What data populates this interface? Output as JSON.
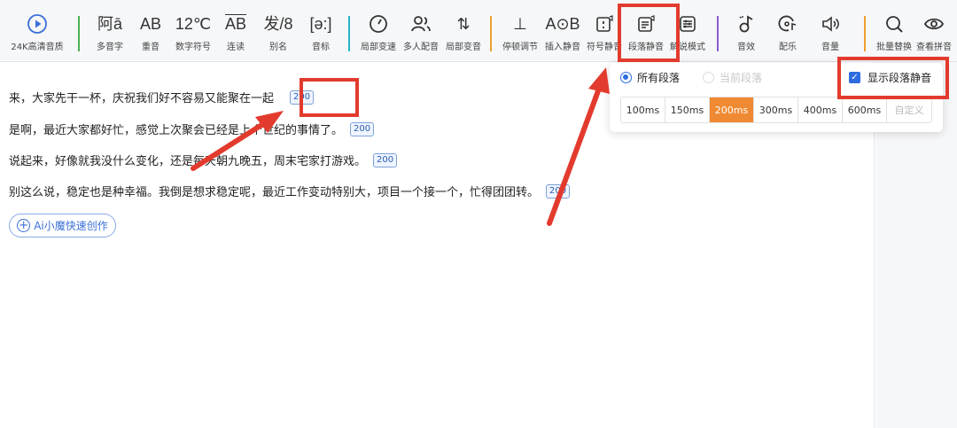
{
  "toolbar": {
    "items": [
      {
        "label": "24K高清音质",
        "icon": "play-circle-icon",
        "glyph": ""
      },
      {
        "label": "多音字",
        "icon": "polyphone-icon",
        "glyph": "阿ā"
      },
      {
        "label": "重音",
        "icon": "stress-icon",
        "glyph": "AB"
      },
      {
        "label": "数字符号",
        "icon": "number-symbol-icon",
        "glyph": "12℃"
      },
      {
        "label": "连读",
        "icon": "liaison-icon",
        "glyph": "AB"
      },
      {
        "label": "别名",
        "icon": "alias-icon",
        "glyph": "发/8"
      },
      {
        "label": "音标",
        "icon": "phonetic-icon",
        "glyph": "[ə:]"
      },
      {
        "label": "局部变速",
        "icon": "speedometer-icon",
        "glyph": "◔"
      },
      {
        "label": "多人配音",
        "icon": "multi-user-icon",
        "glyph": "⚇"
      },
      {
        "label": "局部变音",
        "icon": "voice-change-icon",
        "glyph": "⇅"
      },
      {
        "label": "停顿调节",
        "icon": "pause-adjust-icon",
        "glyph": "⊥"
      },
      {
        "label": "插入静音",
        "icon": "insert-silence-icon",
        "glyph": "A⊙B"
      },
      {
        "label": "符号静音",
        "icon": "symbol-silence-icon",
        "glyph": "⁝"
      },
      {
        "label": "段落静音",
        "icon": "paragraph-silence-icon",
        "glyph": "☰"
      },
      {
        "label": "解说模式",
        "icon": "narration-mode-icon",
        "glyph": "⚌"
      },
      {
        "label": "音效",
        "icon": "sound-effect-icon",
        "glyph": "♪"
      },
      {
        "label": "配乐",
        "icon": "music-icon",
        "glyph": "♫"
      },
      {
        "label": "音量",
        "icon": "volume-icon",
        "glyph": "🔈"
      },
      {
        "label": "批量替换",
        "icon": "search-icon",
        "glyph": "⌕"
      },
      {
        "label": "查看拼音",
        "icon": "eye-icon",
        "glyph": "◉"
      }
    ]
  },
  "editor": {
    "lines": [
      {
        "text": "来，大家先干一杯，庆祝我们好不容易又能聚在一起",
        "badge": "200"
      },
      {
        "text": "是啊，最近大家都好忙，感觉上次聚会已经是上个世纪的事情了。",
        "badge": "200"
      },
      {
        "text": "说起来，好像就我没什么变化，还是每天朝九晚五，周末宅家打游戏。",
        "badge": "200"
      },
      {
        "text": "别这么说，稳定也是种幸福。我倒是想求稳定呢，最近工作变动特别大，项目一个接一个，忙得团团转。",
        "badge": "200"
      }
    ],
    "ai_button_label": "Ai小魔快速创作"
  },
  "popup": {
    "radio_all": "所有段落",
    "radio_current": "当前段落",
    "show_checkbox_label": "显示段落静音",
    "show_checkbox_checked": true,
    "durations": [
      "100ms",
      "150ms",
      "200ms",
      "300ms",
      "400ms",
      "600ms",
      "自定义"
    ],
    "selected_duration": "200ms"
  },
  "colors": {
    "accent": "#2d6cdf",
    "selected": "#f08a32",
    "highlight": "#e23b2e",
    "sep_green": "#4caf50",
    "sep_cyan": "#26b5c9",
    "sep_orange": "#f0a030",
    "sep_purple": "#8a5cd6"
  }
}
